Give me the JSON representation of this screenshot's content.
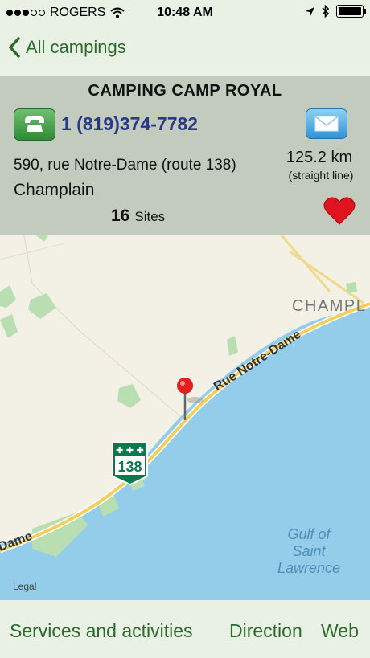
{
  "status_bar": {
    "carrier": "ROGERS",
    "time": "10:48 AM"
  },
  "nav": {
    "back_label": "All campings"
  },
  "camping": {
    "name": "CAMPING CAMP ROYAL",
    "phone": "1 (819)374-7782",
    "address": "590, rue Notre-Dame (route 138)",
    "city": "Champlain",
    "distance": "125.2 km",
    "distance_note": "(straight line)",
    "sites_count": "16",
    "sites_label": "Sites"
  },
  "map": {
    "road_label": "Rue Notre-Dame",
    "road_label_left": "Dame",
    "town_label": "CHAMPL",
    "water_label_1": "Gulf of",
    "water_label_2": "Saint",
    "water_label_3": "Lawrence",
    "route_number": "138",
    "legal": "Legal"
  },
  "tabs": {
    "services": "Services and activities",
    "direction": "Direction",
    "web": "Web"
  },
  "colors": {
    "accent_green": "#2c6a2c",
    "phone_blue": "#283a88",
    "heart_red": "#e0141e",
    "water": "#93cdea",
    "land": "#f3f0e6"
  }
}
